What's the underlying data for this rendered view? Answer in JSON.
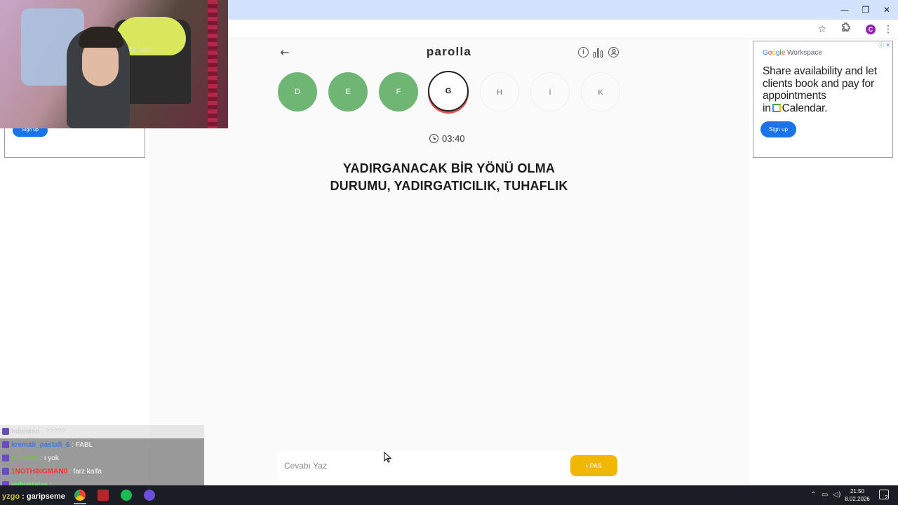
{
  "window": {
    "minimize": "—",
    "restore": "❐",
    "close": "✕"
  },
  "browser": {
    "profile_initial": "C",
    "star_icon": "☆",
    "menu_icon": "⋮"
  },
  "ads": {
    "left": {
      "signup_label": "Sign up"
    },
    "right": {
      "brand_google": "Google",
      "brand_workspace": "Workspace",
      "adchoices": "ⓘ ✕",
      "line1": "Share availability and let clients book and pay for appointments",
      "line2_prefix": "in",
      "line2_suffix": "Calendar.",
      "signup_label": "Sign up"
    }
  },
  "game": {
    "title": "parolla",
    "back_icon": "←",
    "info_icon": "i",
    "letters": [
      {
        "char": "D",
        "state": "done"
      },
      {
        "char": "E",
        "state": "done"
      },
      {
        "char": "F",
        "state": "done"
      },
      {
        "char": "G",
        "state": "current"
      },
      {
        "char": "H",
        "state": "pending"
      },
      {
        "char": "İ",
        "state": "pending"
      },
      {
        "char": "K",
        "state": "pending"
      }
    ],
    "timer": "03:40",
    "question_line1": "YADIRGANACAK BİR YÖNÜ OLMA",
    "question_line2": "DURUMU, YADIRGATICILIK, TUHAFLIK",
    "answer_placeholder": "Cevabı Yaz",
    "answer_value": "",
    "pass_label": "› PAS",
    "colors": {
      "done": "#6fb574",
      "current_ring": "#e25555",
      "pass": "#f2b705"
    }
  },
  "webcam": {
    "chair_text": "TITAN"
  },
  "chat": [
    {
      "user": "hdwstan",
      "text": ": ?????",
      "color": "#cccccc",
      "faded": true
    },
    {
      "user": "kremali_pastali_6",
      "text": ": FABL",
      "color": "#3d7ae0",
      "faded": false
    },
    {
      "user": "Gilzeem",
      "text": ": ı yok",
      "color": "#7bbf4a",
      "faded": false
    },
    {
      "user": "1NOTHINGMAN0",
      "text": ": farz kalfa",
      "color": "#ff3333",
      "faded": false
    },
    {
      "user": "yubuktalas",
      "text": ":",
      "color": "#6cf06c",
      "faded": false
    }
  ],
  "subtitle": {
    "user": "yzgo",
    "text": ": garipseme"
  },
  "taskbar": {
    "time": "21:50",
    "date": "8.02.2026",
    "notifications": "2"
  }
}
